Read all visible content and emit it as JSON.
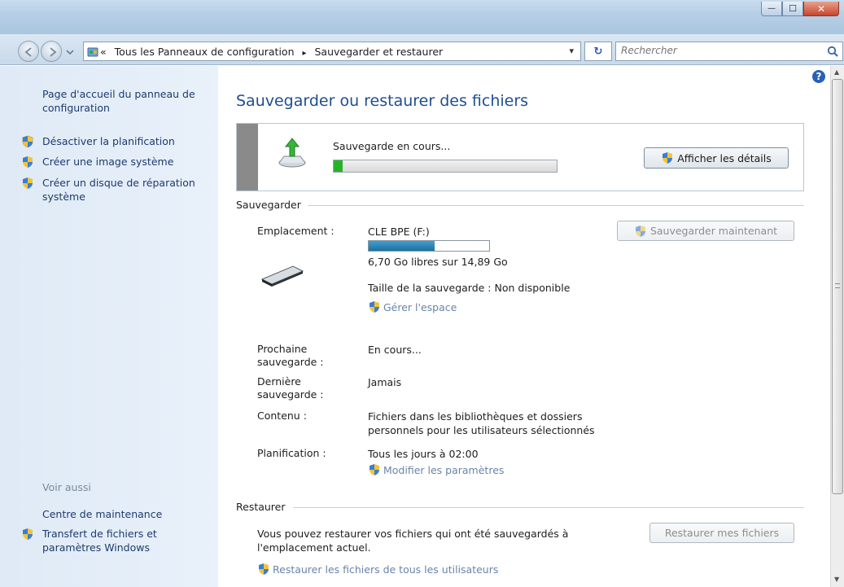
{
  "window": {
    "controls": {
      "minimize": "—",
      "maximize": "☐",
      "close": "✕"
    }
  },
  "nav": {
    "crumb_prefix": "«",
    "crumbs": [
      "Tous les Panneaux de configuration",
      "Sauvegarder et restaurer"
    ],
    "separator": "▸",
    "dropdown": "▾",
    "refresh": "↻",
    "search_placeholder": "Rechercher"
  },
  "sidebar": {
    "home_link": "Page d'accueil du panneau de configuration",
    "items": [
      {
        "label": "Désactiver la planification",
        "icon": "uac-shield-icon"
      },
      {
        "label": "Créer une image système",
        "icon": "uac-shield-icon"
      },
      {
        "label": "Créer un disque de réparation système",
        "icon": "uac-shield-icon"
      }
    ],
    "see_also_heading": "Voir aussi",
    "see_also": [
      {
        "label": "Centre de maintenance",
        "icon": ""
      },
      {
        "label": "Transfert de fichiers et paramètres Windows",
        "icon": "uac-shield-icon"
      }
    ]
  },
  "main": {
    "title": "Sauvegarder ou restaurer des fichiers",
    "help": "?",
    "status": {
      "text": "Sauvegarde en cours...",
      "progress": 0.04,
      "details_button": "Afficher les détails"
    },
    "backup": {
      "heading": "Sauvegarder",
      "location_label": "Emplacement :",
      "location_value": "CLE BPE (F:)",
      "disk_usage": 0.55,
      "free_space": "6,70 Go libres sur 14,89 Go",
      "size_line": "Taille de la sauvegarde : Non disponible",
      "manage_space": "Gérer l'espace",
      "backup_now_button": "Sauvegarder maintenant",
      "next_label": "Prochaine sauvegarde :",
      "next_value": "En cours...",
      "last_label": "Dernière sauvegarde :",
      "last_value": "Jamais",
      "content_label": "Contenu :",
      "content_value": "Fichiers dans les bibliothèques et dossiers personnels pour les utilisateurs sélectionnés",
      "schedule_label": "Planification :",
      "schedule_value": "Tous les jours à 02:00",
      "change_settings": "Modifier les paramètres"
    },
    "restore": {
      "heading": "Restaurer",
      "description": "Vous pouvez restaurer vos fichiers qui ont été sauvegardés à l'emplacement actuel.",
      "restore_button": "Restaurer mes fichiers",
      "restore_all_link": "Restaurer les fichiers de tous les utilisateurs"
    }
  },
  "colors": {
    "link": "#1e3a6e",
    "title": "#1f4e8f",
    "progress_green": "#27b327",
    "disk_bar": "#2b86b7"
  }
}
